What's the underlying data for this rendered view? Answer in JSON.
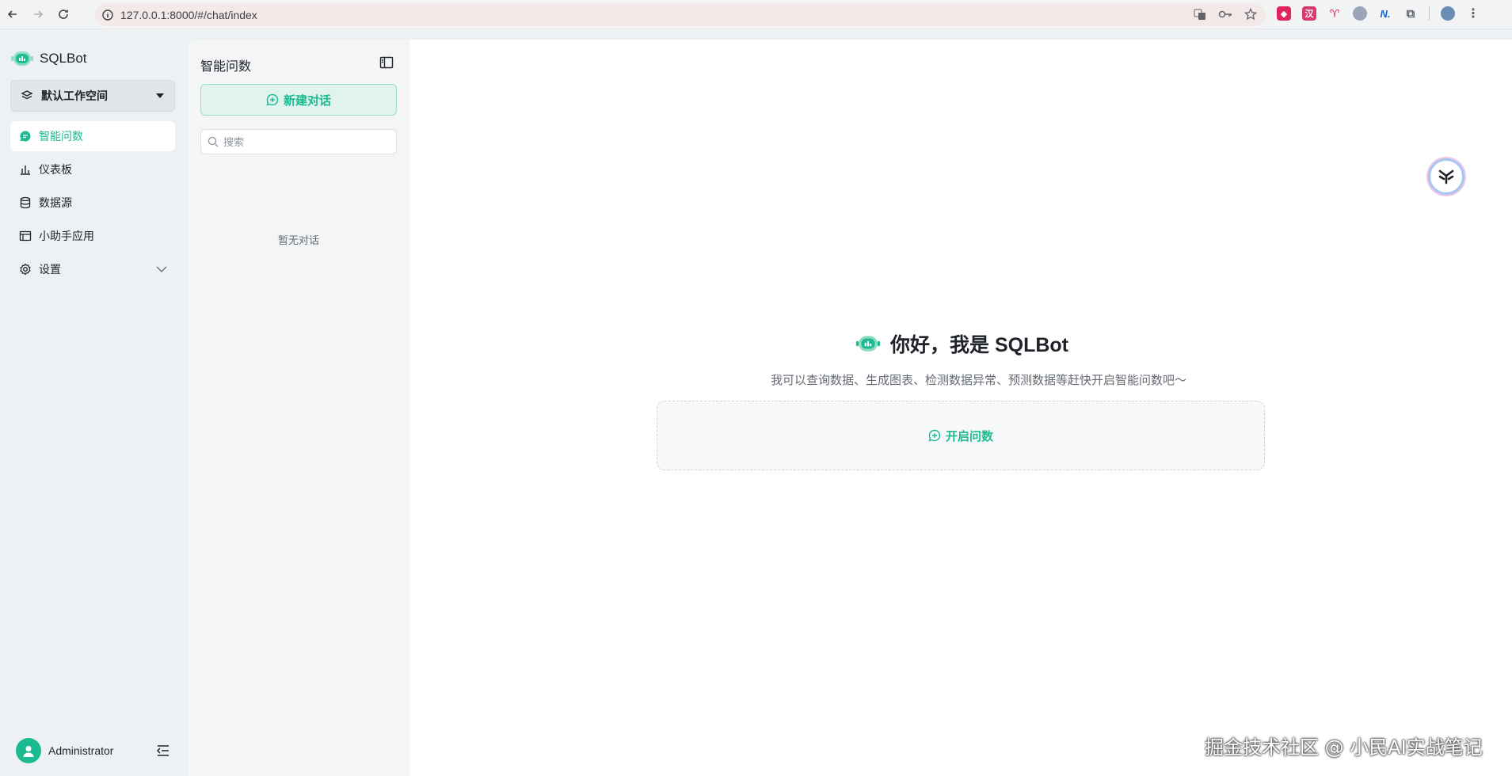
{
  "browser": {
    "url": "127.0.0.1:8000/#/chat/index"
  },
  "sidebar": {
    "brand": "SQLBot",
    "workspace": "默认工作空间",
    "items": [
      {
        "label": "智能问数",
        "icon": "chat-icon",
        "active": true
      },
      {
        "label": "仪表板",
        "icon": "bar-chart-icon"
      },
      {
        "label": "数据源",
        "icon": "database-icon"
      },
      {
        "label": "小助手应用",
        "icon": "app-window-icon"
      },
      {
        "label": "设置",
        "icon": "gear-icon"
      }
    ],
    "user": "Administrator"
  },
  "chat_panel": {
    "title": "智能问数",
    "new_chat_label": "新建对话",
    "search_placeholder": "搜索",
    "empty_text": "暂无对话"
  },
  "main": {
    "greeting": "你好，我是 SQLBot",
    "subtitle": "我可以查询数据、生成图表、检测数据异常、预测数据等赶快开启智能问数吧～",
    "start_label": "开启问数"
  },
  "watermark": "掘金技术社区 @ 小民AI实战笔记",
  "colors": {
    "accent": "#1cba90",
    "sidebar_bg": "#eef1f3",
    "panel_bg": "#f3f5f6"
  }
}
